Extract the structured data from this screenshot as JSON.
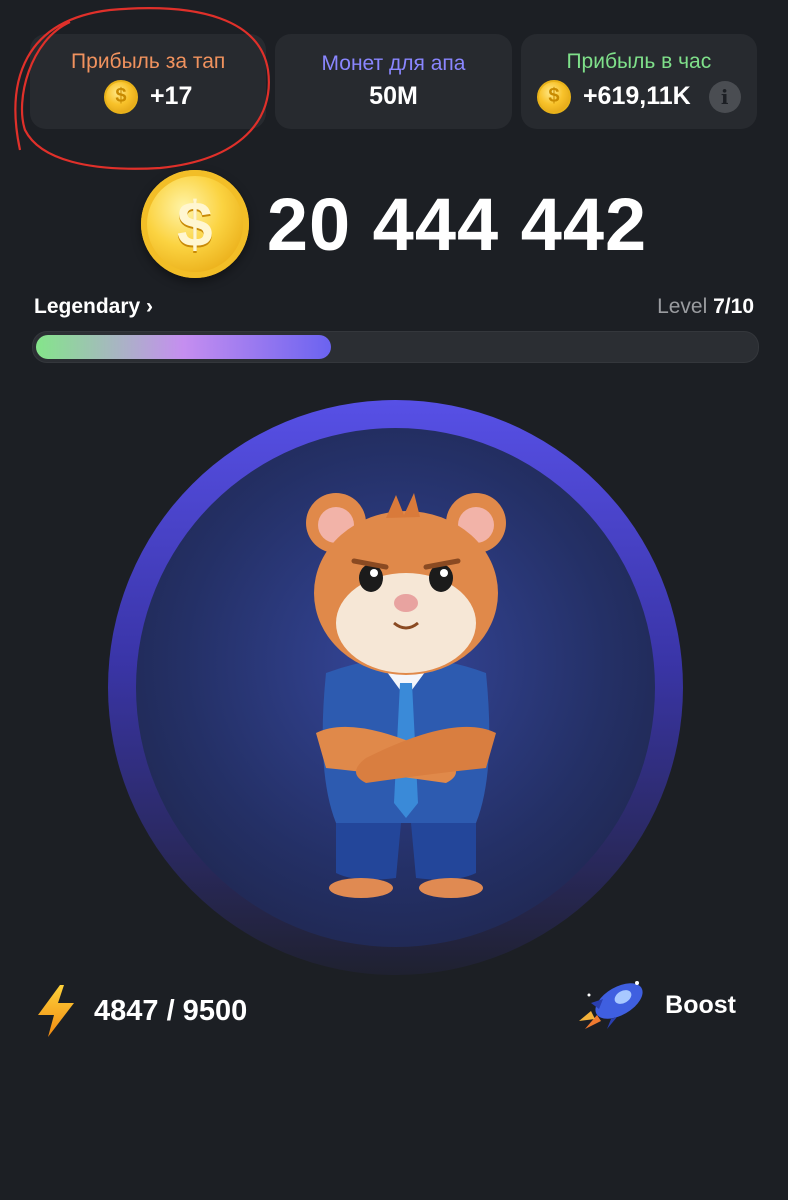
{
  "stats": [
    {
      "label": "Прибыль за тап",
      "value": "+17",
      "color": "#f0925e",
      "has_coin": true,
      "has_info": false
    },
    {
      "label": "Монет для апа",
      "value": "50M",
      "color": "#8a86ff",
      "has_coin": false,
      "has_info": false
    },
    {
      "label": "Прибыль в час",
      "value": "+619,11K",
      "color": "#7fe08a",
      "has_coin": true,
      "has_info": true
    }
  ],
  "balance": "20 444 442",
  "league": {
    "name": "Legendary",
    "chevron": "›"
  },
  "level": {
    "prefix": "Level",
    "value": "7/10",
    "progress": 0.41
  },
  "energy": {
    "current": "4847",
    "max": "9500",
    "text": "4847 / 9500"
  },
  "boost": {
    "label": "Boost"
  },
  "icons": {
    "coin": "coin-icon",
    "info": "info-icon",
    "energy": "lightning-icon",
    "boost": "rocket-icon"
  },
  "colors": {
    "background": "#1c1f24",
    "card": "#272a2f",
    "accent_gold": "#f8c22a",
    "annotation_red": "#e0302a"
  }
}
